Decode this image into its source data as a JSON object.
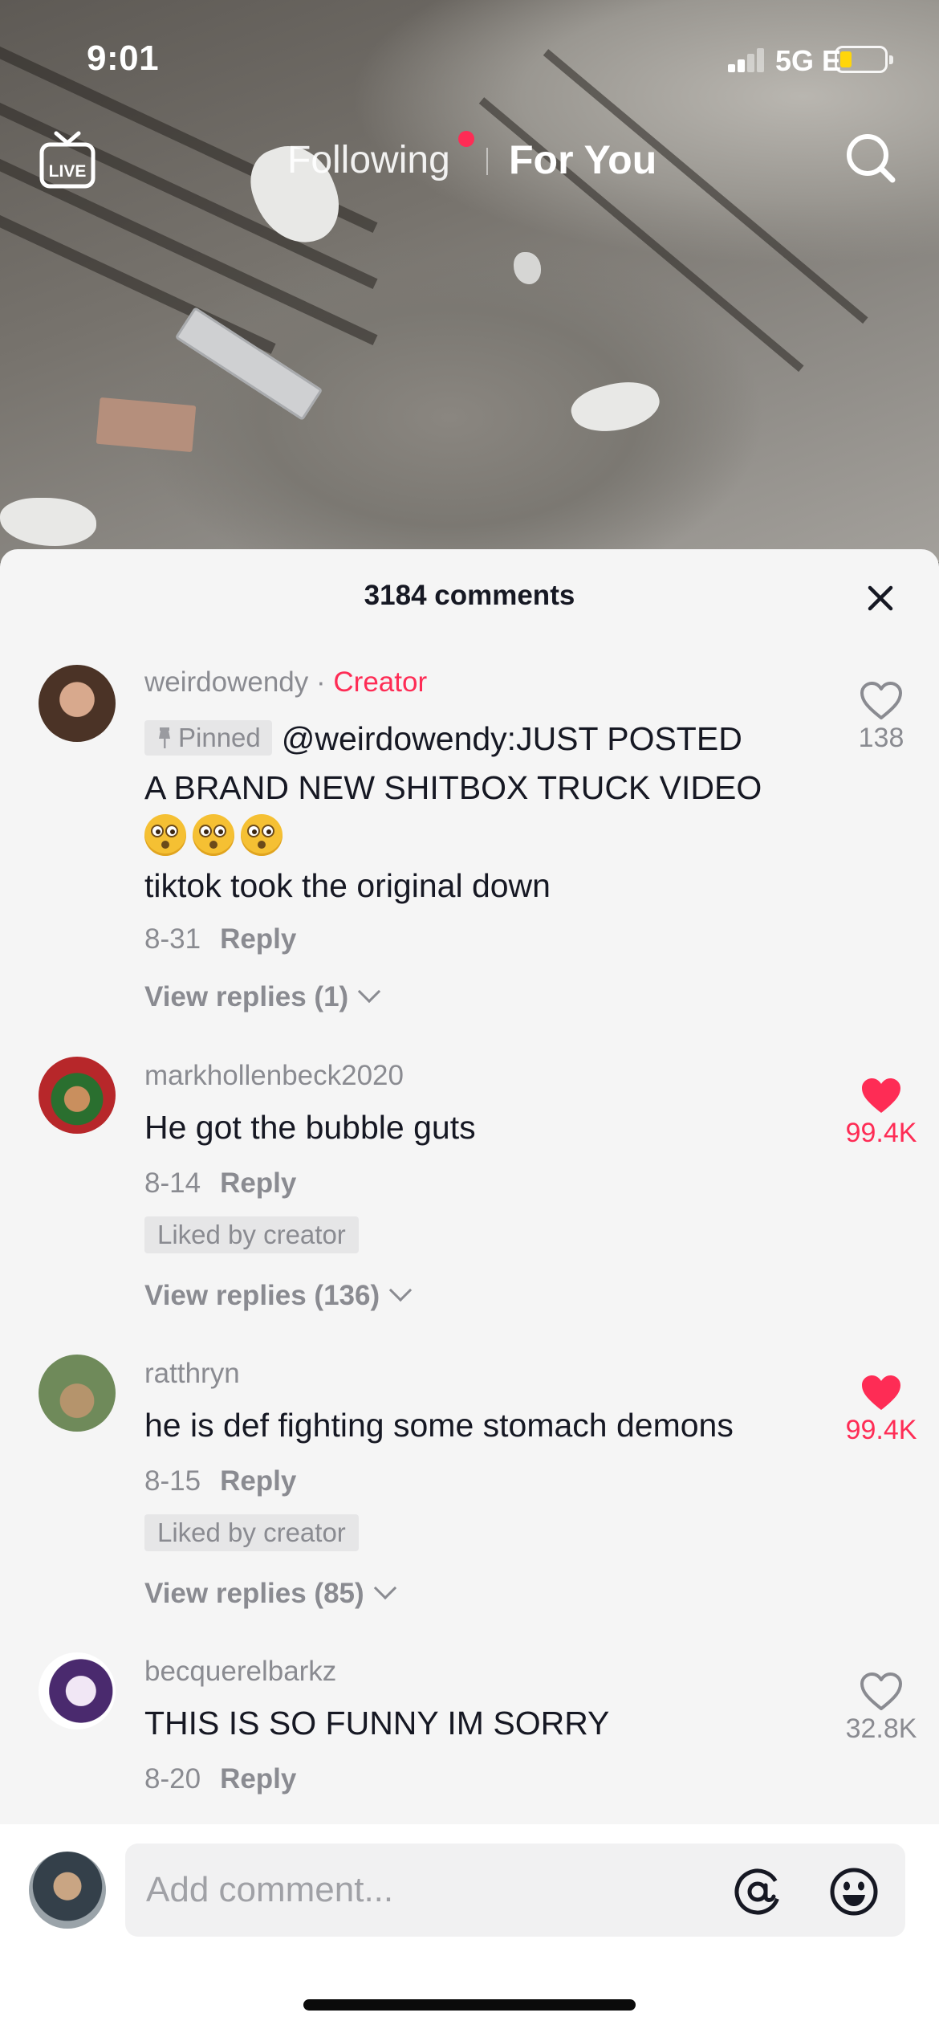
{
  "status_bar": {
    "time": "9:01",
    "network": "5G E"
  },
  "nav": {
    "live_label": "LIVE",
    "following": "Following",
    "for_you": "For You"
  },
  "comments_sheet": {
    "title": "3184 comments",
    "comments": [
      {
        "username": "weirdowendy",
        "separator": "·",
        "creator_tag": "Creator",
        "pinned_label": "Pinned",
        "text_line1": "@weirdowendy:JUST POSTED",
        "text_line2": "A BRAND NEW SHITBOX TRUCK VIDEO",
        "emoji": "😳😳😳",
        "text_line4": "tiktok took the original down",
        "date": "8-31",
        "reply": "Reply",
        "view_replies": "View replies (1)",
        "likes": "138",
        "liked": false
      },
      {
        "username": "markhollenbeck2020",
        "text": "He got the bubble guts",
        "date": "8-14",
        "reply": "Reply",
        "badge": "Liked by creator",
        "view_replies": "View replies (136)",
        "likes": "99.4K",
        "liked": true
      },
      {
        "username": "ratthryn",
        "text": "he is def fighting some stomach demons",
        "date": "8-15",
        "reply": "Reply",
        "badge": "Liked by creator",
        "view_replies": "View replies (85)",
        "likes": "99.4K",
        "liked": true
      },
      {
        "username": "becquerelbarkz",
        "text": "THIS IS SO FUNNY IM SORRY",
        "date": "8-20",
        "reply": "Reply",
        "likes": "32.8K",
        "liked": false
      }
    ]
  },
  "input": {
    "placeholder": "Add comment..."
  },
  "icons": [
    "live-icon",
    "search-icon",
    "close-icon",
    "pin-icon",
    "heart-outline-icon",
    "heart-filled-icon",
    "chevron-down-icon",
    "at-icon",
    "emoji-icon"
  ],
  "colors": {
    "accent": "#fe2c55",
    "muted_text": "#8a8b91",
    "primary_text": "#161823",
    "sheet_bg": "#f5f5f5"
  }
}
